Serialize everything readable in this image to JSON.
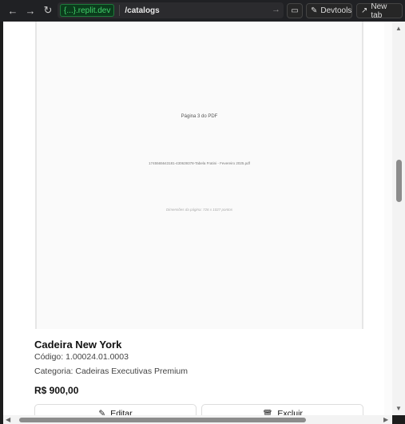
{
  "browser": {
    "domain": "{...}.replit.dev",
    "path": "/catalogs",
    "devtools_label": "Devtools",
    "newtab_label": "New tab"
  },
  "pdf_preview": {
    "page_label": "Página 3 do PDF",
    "file_name": "1745565643181-430639378-Tabela Fratini - Fevereiro 2025.pdf",
    "dimensions": "Dimensões da página: 726 x 1027 pontos"
  },
  "product": {
    "name": "Cadeira New York",
    "code": "Código: 1.00024.01.0003",
    "category": "Categoria: Cadeiras Executivas Premium",
    "price": "R$ 900,00",
    "edit_label": "Editar",
    "delete_label": "Excluir"
  },
  "icons": {
    "back": "arrow-left-icon",
    "forward": "arrow-right-icon",
    "reload": "reload-icon",
    "screen": "screen-icon",
    "devtools": "wrench-icon",
    "newtab": "external-link-icon",
    "edit": "pencil-icon",
    "delete": "trash-icon"
  }
}
